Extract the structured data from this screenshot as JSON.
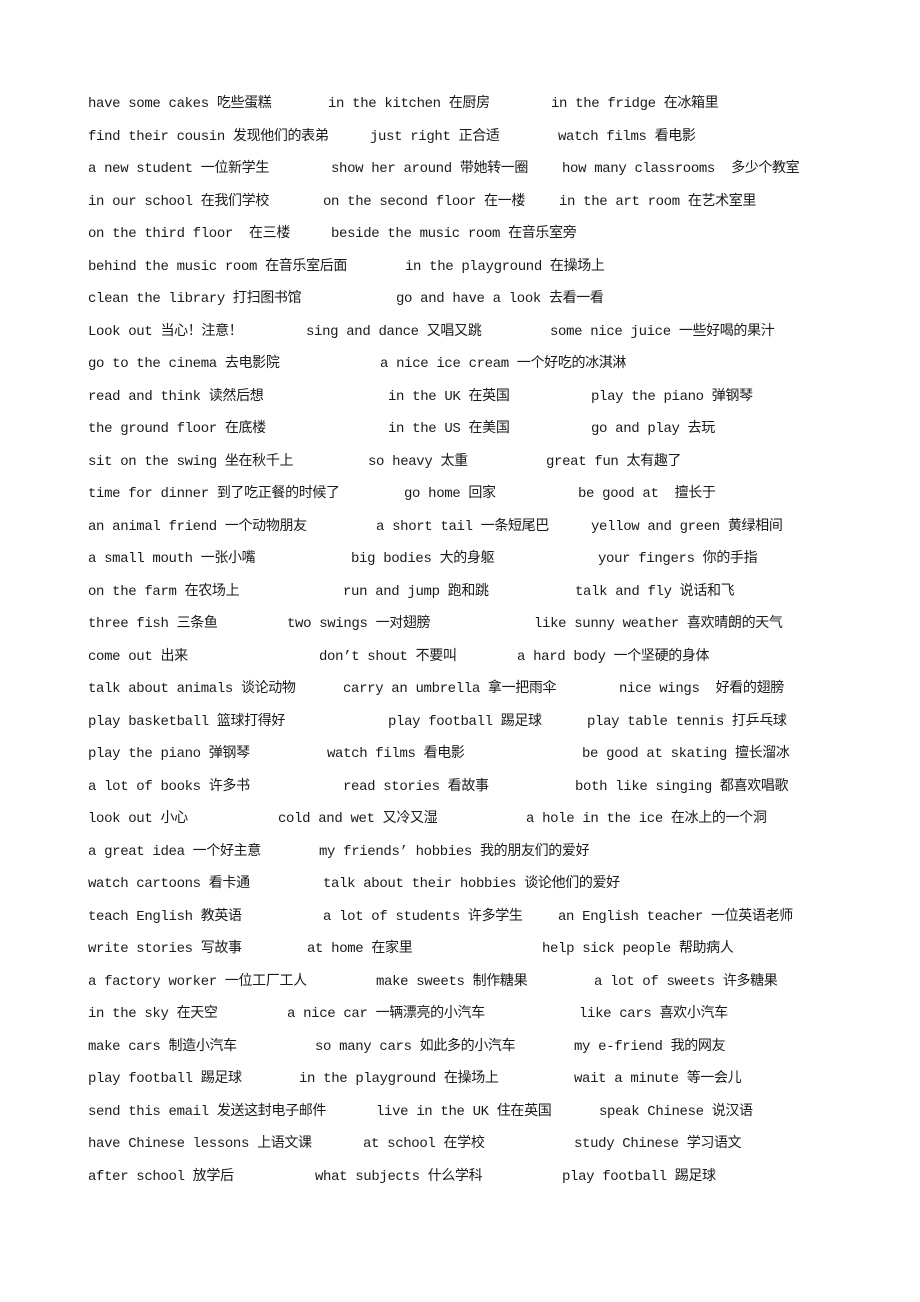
{
  "document": {
    "rows": [
      [
        "have some cakes 吃些蛋糕",
        "in the kitchen 在厨房",
        "in the fridge 在冰箱里"
      ],
      [
        "find their cousin 发现他们的表弟",
        "just right 正合适",
        "watch films 看电影"
      ],
      [
        "a new student 一位新学生",
        "show her around 带她转一圈",
        "how many classrooms  多少个教室"
      ],
      [
        "in our school 在我们学校",
        "on the second floor 在一楼",
        "in the art room 在艺术室里"
      ],
      [
        "on the third floor  在三楼",
        "beside the music room 在音乐室旁",
        ""
      ],
      [
        "behind the music room 在音乐室后面",
        "in the playground 在操场上",
        ""
      ],
      [
        "clean the library 打扫图书馆",
        "go and have a look 去看一看",
        ""
      ],
      [
        "Look out 当心！注意！",
        "sing and dance 又唱又跳",
        "some nice juice 一些好喝的果汁"
      ],
      [
        "go to the cinema 去电影院",
        "a nice ice cream 一个好吃的冰淇淋",
        ""
      ],
      [
        "read and think 读然后想",
        "in the UK 在英国",
        "play the piano 弹钢琴"
      ],
      [
        "the ground floor 在底楼",
        "in the US 在美国",
        "go and play 去玩"
      ],
      [
        "sit on the swing 坐在秋千上",
        "so heavy 太重",
        "great fun 太有趣了"
      ],
      [
        "time for dinner 到了吃正餐的时候了",
        "go home 回家",
        "be good at  擅长于"
      ],
      [
        "an animal friend 一个动物朋友",
        "a short tail 一条短尾巴",
        "yellow and green 黄绿相间"
      ],
      [
        "a small mouth 一张小嘴",
        "big bodies 大的身躯",
        "your fingers 你的手指"
      ],
      [
        "on the farm 在农场上",
        "run and jump 跑和跳",
        "talk and fly 说话和飞"
      ],
      [
        "three fish 三条鱼",
        "two swings 一对翅膀",
        "like sunny weather 喜欢晴朗的天气"
      ],
      [
        "come out 出来",
        "don’t shout 不要叫",
        "a hard body 一个坚硬的身体"
      ],
      [
        "talk about animals 谈论动物",
        "carry an umbrella 拿一把雨伞",
        "nice wings  好看的翅膀"
      ],
      [
        "play basketball 篮球打得好",
        "play football 踢足球",
        "play table tennis 打乒乓球"
      ],
      [
        "play the piano 弹钢琴",
        "watch films 看电影",
        "be good at skating 擅长溜冰"
      ],
      [
        "a lot of books 许多书",
        "read stories 看故事",
        "both like singing 都喜欢唱歌"
      ],
      [
        "look out 小心",
        "cold and wet 又冷又湿",
        "a hole in the ice 在冰上的一个洞"
      ],
      [
        "a great idea 一个好主意",
        "my friends’ hobbies 我的朋友们的爱好",
        ""
      ],
      [
        "watch cartoons 看卡通",
        "talk about their hobbies 谈论他们的爱好",
        ""
      ],
      [
        "teach English 教英语",
        "a lot of students 许多学生",
        "an English teacher 一位英语老师"
      ],
      [
        "write stories 写故事",
        "at home 在家里",
        "help sick people 帮助病人"
      ],
      [
        "a factory worker 一位工厂工人",
        "make sweets 制作糖果",
        "a lot of sweets 许多糖果"
      ],
      [
        "in the sky 在天空",
        "a nice car 一辆漂亮的小汽车",
        "like cars 喜欢小汽车"
      ],
      [
        "make cars 制造小汽车",
        "so many cars 如此多的小汽车",
        "my e-friend 我的网友"
      ],
      [
        "play football 踢足球",
        "in the playground 在操场上",
        "wait a minute 等一会儿"
      ],
      [
        "send this email 发送这封电子邮件",
        "live in the UK 住在英国",
        "speak Chinese 说汉语"
      ],
      [
        "have Chinese lessons 上语文课",
        "at school 在学校",
        "study Chinese 学习语文"
      ],
      [
        "after school 放学后",
        "what subjects 什么学科",
        "play football 踢足球"
      ]
    ]
  }
}
